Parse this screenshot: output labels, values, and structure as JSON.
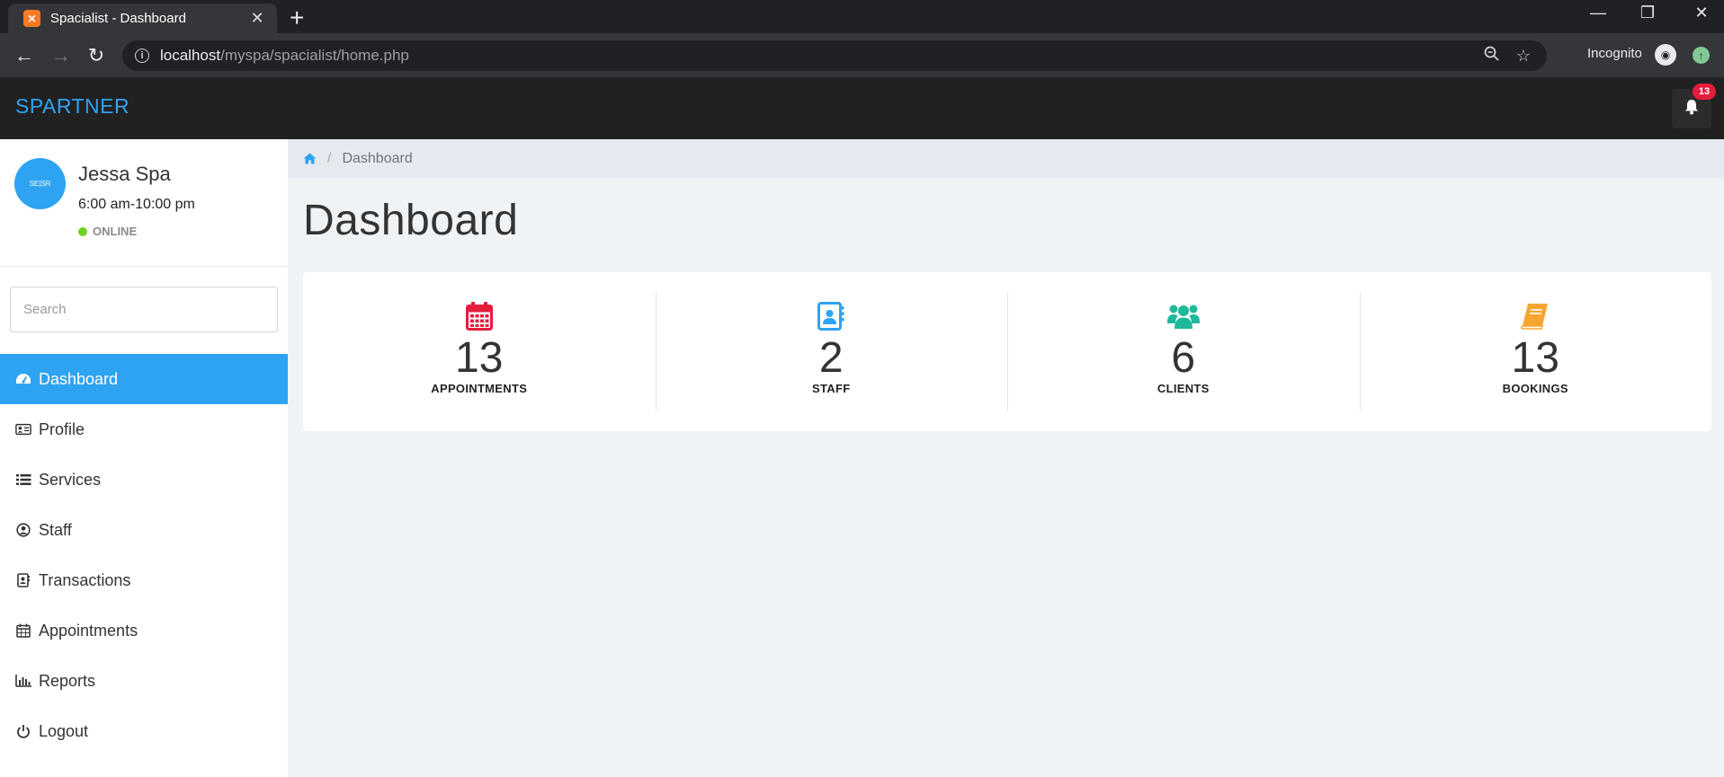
{
  "browser": {
    "tab_title": "Spacialist - Dashboard",
    "url_host": "localhost",
    "url_path": "/myspa/spacialist/home.php",
    "profile_label": "Incognito"
  },
  "header": {
    "brand": "SPARTNER",
    "notification_count": "13"
  },
  "user": {
    "avatar_text": "SE|SR",
    "name": "Jessa Spa",
    "hours": "6:00 am-10:00 pm",
    "status": "ONLINE"
  },
  "search": {
    "placeholder": "Search"
  },
  "menu": {
    "items": [
      {
        "label": "Dashboard",
        "icon": "tachometer-icon",
        "active": true
      },
      {
        "label": "Profile",
        "icon": "id-card-icon"
      },
      {
        "label": "Services",
        "icon": "list-icon"
      },
      {
        "label": "Staff",
        "icon": "user-circle-icon"
      },
      {
        "label": "Transactions",
        "icon": "contact-book-icon"
      },
      {
        "label": "Appointments",
        "icon": "calendar-icon"
      },
      {
        "label": "Reports",
        "icon": "bar-chart-icon"
      },
      {
        "label": "Logout",
        "icon": "power-icon"
      }
    ]
  },
  "breadcrumb": {
    "current": "Dashboard"
  },
  "page": {
    "title": "Dashboard"
  },
  "stats": [
    {
      "value": "13",
      "label": "APPOINTMENTS",
      "icon": "calendar-icon",
      "color": "#e51c3c"
    },
    {
      "value": "2",
      "label": "STAFF",
      "icon": "contact-book-icon",
      "color": "#2ea3f2"
    },
    {
      "value": "6",
      "label": "CLIENTS",
      "icon": "users-icon",
      "color": "#1fb99a"
    },
    {
      "value": "13",
      "label": "BOOKINGS",
      "icon": "book-icon",
      "color": "#f7a531"
    }
  ],
  "colors": {
    "accent": "#2ea3f2",
    "header_bg": "#212121",
    "online": "#6ed21e",
    "badge": "#e51c3c"
  }
}
